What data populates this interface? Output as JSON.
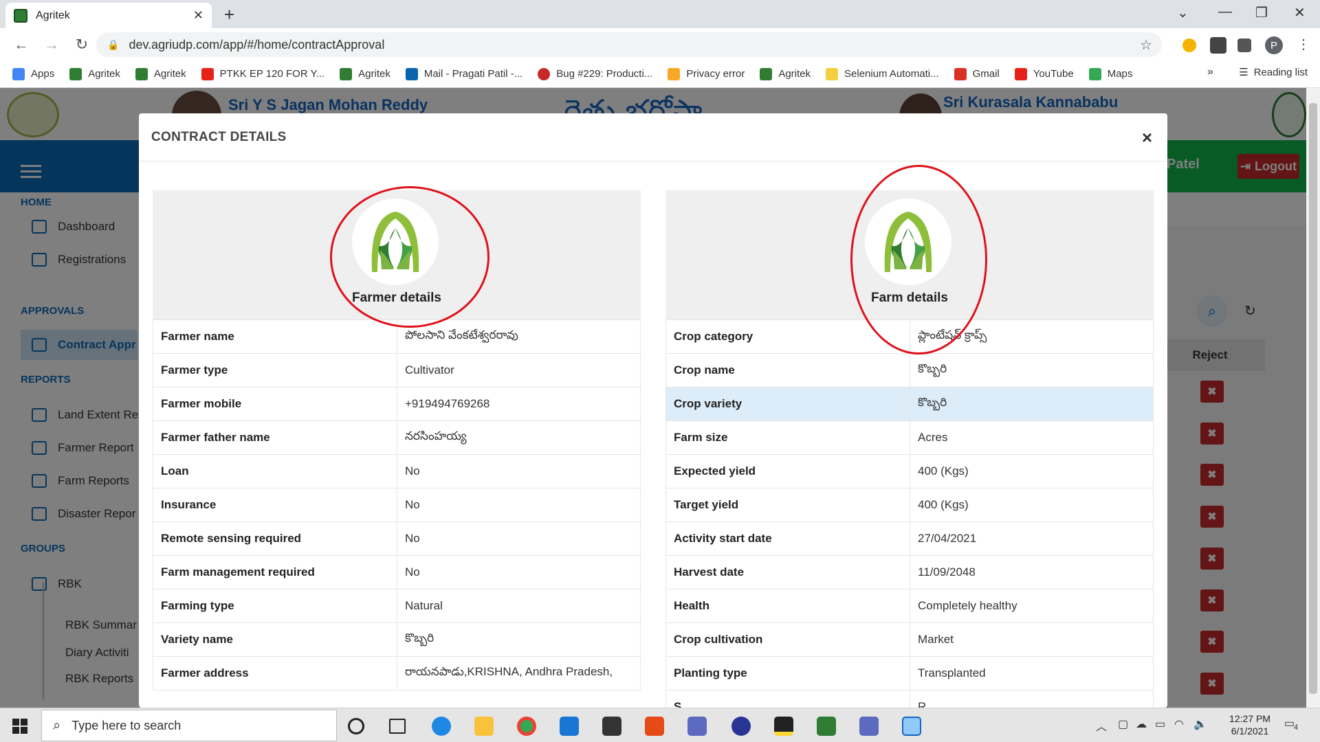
{
  "browser": {
    "tab_title": "Agritek",
    "url": "dev.agriudp.com/app/#/home/contractApproval",
    "profile_initial": "P",
    "bookmarks": [
      {
        "label": "Apps",
        "color": "#4285f4"
      },
      {
        "label": "Agritek",
        "color": "#2e7d32"
      },
      {
        "label": "Agritek",
        "color": "#2e7d32"
      },
      {
        "label": "PTKK EP 120 FOR Y...",
        "color": "#e62117"
      },
      {
        "label": "Agritek",
        "color": "#2e7d32"
      },
      {
        "label": "Mail - Pragati Patil -...",
        "color": "#0a64ad"
      },
      {
        "label": "Bug #229: Producti...",
        "color": "#c62828"
      },
      {
        "label": "Privacy error",
        "color": "#f9a825"
      },
      {
        "label": "Agritek",
        "color": "#2e7d32"
      },
      {
        "label": "Selenium Automati...",
        "color": "#f4d03f"
      },
      {
        "label": "Gmail",
        "color": "#d93025"
      },
      {
        "label": "YouTube",
        "color": "#e62117"
      },
      {
        "label": "Maps",
        "color": "#34a853"
      }
    ],
    "overflow": "»",
    "reading_list": "Reading list"
  },
  "banner": {
    "left_name": "Sri Y S Jagan Mohan Reddy",
    "center_title": "రైతు భరోసా",
    "right_name": "Sri Kurasala Kannababu"
  },
  "topbar": {
    "user": "Patel",
    "logout": "Logout"
  },
  "sidebar": {
    "sections": {
      "home": "HOME",
      "approvals": "APPROVALS",
      "reports": "REPORTS",
      "groups": "GROUPS"
    },
    "items": {
      "dashboard": "Dashboard",
      "registrations": "Registrations",
      "contract": "Contract Appr",
      "land": "Land Extent Re",
      "farmer_report": "Farmer Report",
      "farm_reports": "Farm Reports",
      "disaster": "Disaster Repor",
      "rbk": "RBK",
      "rbk_summary": "RBK Summar",
      "diary": "Diary Activiti",
      "rbk_reports": "RBK Reports"
    }
  },
  "right": {
    "reject_header": "Reject",
    "reject_icon": "✖"
  },
  "modal": {
    "title": "CONTRACT DETAILS",
    "close": "×",
    "farmer": {
      "title": "Farmer details",
      "rows": [
        {
          "k": "Farmer name",
          "v": "పోలసాని వేంకటేశ్వరరావు"
        },
        {
          "k": "Farmer type",
          "v": "Cultivator"
        },
        {
          "k": "Farmer mobile",
          "v": "+919494769268"
        },
        {
          "k": "Farmer father name",
          "v": "నరసింహయ్య"
        },
        {
          "k": "Loan",
          "v": "No"
        },
        {
          "k": "Insurance",
          "v": "No"
        },
        {
          "k": "Remote sensing required",
          "v": "No"
        },
        {
          "k": "Farm management required",
          "v": "No"
        },
        {
          "k": "Farming type",
          "v": "Natural"
        },
        {
          "k": "Variety name",
          "v": "కొబ్బరి"
        },
        {
          "k": "Farmer address",
          "v": "రాయనపాడు,KRISHNA, Andhra Pradesh,"
        }
      ]
    },
    "farm": {
      "title": "Farm details",
      "rows": [
        {
          "k": "Crop category",
          "v": "ప్లాంటేషన్ క్రాప్స్"
        },
        {
          "k": "Crop name",
          "v": "కొబ్బరి"
        },
        {
          "k": "Crop variety",
          "v": "కొబ్బరి"
        },
        {
          "k": "Farm size",
          "v": "Acres"
        },
        {
          "k": "Expected yield",
          "v": "400 (Kgs)"
        },
        {
          "k": "Target yield",
          "v": "400 (Kgs)"
        },
        {
          "k": "Activity start date",
          "v": "27/04/2021"
        },
        {
          "k": "Harvest date",
          "v": "11/09/2048"
        },
        {
          "k": "Health",
          "v": "Completely healthy"
        },
        {
          "k": "Crop cultivation",
          "v": "Market"
        },
        {
          "k": "Planting type",
          "v": "Transplanted"
        },
        {
          "k": "S",
          "v": "R"
        }
      ]
    }
  },
  "taskbar": {
    "search_placeholder": "Type here to search",
    "time": "12:27 PM",
    "date": "6/1/2021",
    "notifications": "4"
  }
}
